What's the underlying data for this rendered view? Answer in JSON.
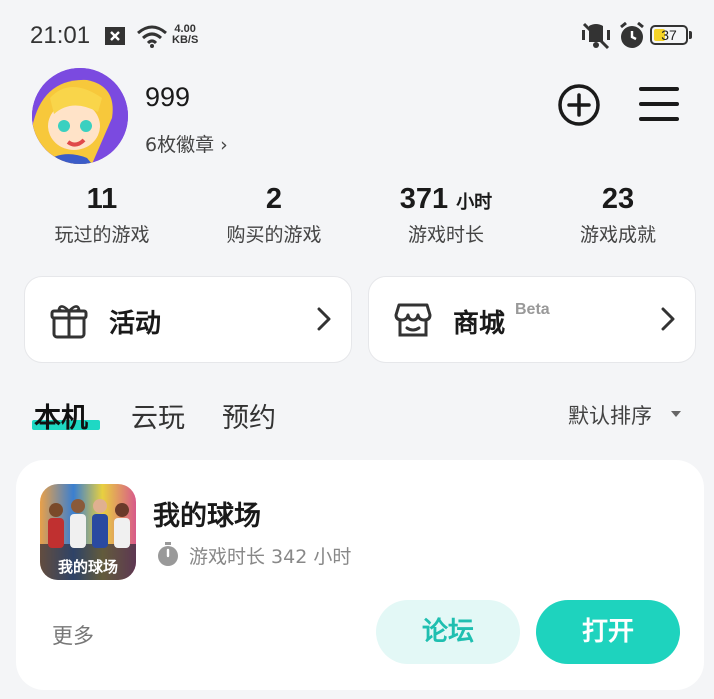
{
  "status_bar": {
    "time": "21:01",
    "net_speed_value": "4.00",
    "net_speed_unit": "KB/S",
    "battery": "37",
    "battery_level": 0.37
  },
  "profile": {
    "username": "999",
    "badges_label": "6枚徽章 ›"
  },
  "stats": [
    {
      "value": "11",
      "unit": "",
      "label": "玩过的游戏"
    },
    {
      "value": "2",
      "unit": "",
      "label": "购买的游戏"
    },
    {
      "value": "371",
      "unit": "小时",
      "label": "游戏时长"
    },
    {
      "value": "23",
      "unit": "",
      "label": "游戏成就"
    }
  ],
  "cards": {
    "activity": {
      "label": "活动"
    },
    "store": {
      "label": "商城",
      "badge": "Beta"
    }
  },
  "tabs": [
    {
      "label": "本机",
      "active": true
    },
    {
      "label": "云玩",
      "active": false
    },
    {
      "label": "预约",
      "active": false
    }
  ],
  "sort_label": "默认排序",
  "game": {
    "title": "我的球场",
    "playtime": "游戏时长 342 小时",
    "icon_caption": "我的球场",
    "more_label": "更多",
    "forum_label": "论坛",
    "open_label": "打开"
  },
  "colors": {
    "accent": "#1ed3be",
    "accent_light": "#e3f8f6",
    "avatar_bg": "#7b4ae0"
  }
}
